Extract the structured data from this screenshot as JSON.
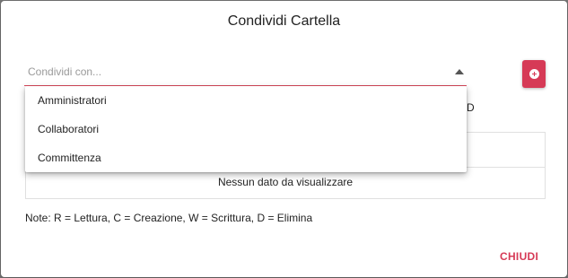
{
  "dialog": {
    "title": "Condividi Cartella",
    "share_select": {
      "placeholder": "Condividi con...",
      "options": [
        "Amministratori",
        "Collaboratori",
        "Committenza"
      ]
    },
    "add_button_icon": "plus-circle-icon",
    "permissions_header_partial": "D",
    "table": {
      "empty_message": "Nessun dato da visualizzare"
    },
    "note": "Note: R = Lettura, C = Creazione, W = Scrittura, D = Elimina",
    "close_label": "CHIUDI"
  },
  "colors": {
    "accent": "#d63a56",
    "backdrop": "#7a7a7a"
  }
}
